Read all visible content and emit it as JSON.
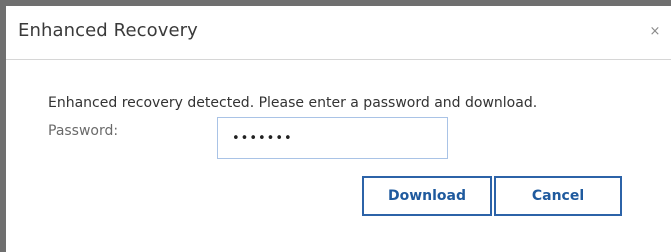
{
  "dialog": {
    "title": "Enhanced Recovery",
    "close_glyph": "×",
    "message": "Enhanced recovery detected. Please enter a password and download.",
    "password_label": "Password:",
    "password_value": "•••••••",
    "buttons": {
      "download": "Download",
      "cancel": "Cancel"
    }
  },
  "colors": {
    "background": "#6f6f6f",
    "dialog": "#ffffff",
    "button_border": "#2c63a8",
    "button_text": "#1f5a9e",
    "input_border": "#a9c3e6"
  },
  "icons": {
    "close": "close-icon"
  }
}
